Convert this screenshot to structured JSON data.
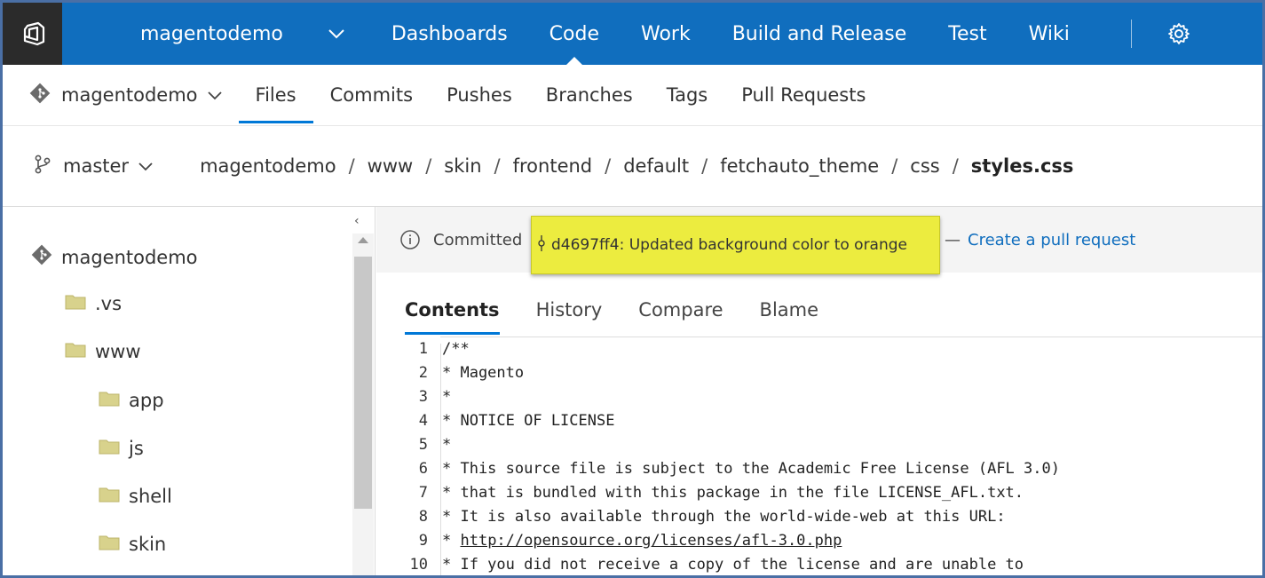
{
  "colors": {
    "nav_bg": "#106ebe",
    "logo_bg": "#2b2b2b",
    "accent": "#0078d7",
    "highlight": "#ecec3f",
    "link": "#106ebe"
  },
  "topnav": {
    "project": "magentodemo",
    "links": [
      "Dashboards",
      "Code",
      "Work",
      "Build and Release",
      "Test",
      "Wiki"
    ],
    "active": "Code",
    "icons": {
      "logo": "vsts-logo-icon",
      "project_dropdown": "chevron-down-icon",
      "settings": "gear-icon"
    }
  },
  "subnav": {
    "repo": "magentodemo",
    "tabs": [
      "Files",
      "Commits",
      "Pushes",
      "Branches",
      "Tags",
      "Pull Requests"
    ],
    "active": "Files"
  },
  "pathbar": {
    "branch": "master",
    "crumbs": [
      "magentodemo",
      "www",
      "skin",
      "frontend",
      "default",
      "fetchauto_theme",
      "css"
    ],
    "current": "styles.css"
  },
  "tree": {
    "items": [
      {
        "label": "magentodemo",
        "type": "repo"
      },
      {
        "label": ".vs",
        "type": "folder"
      },
      {
        "label": "www",
        "type": "folder"
      },
      {
        "label": "app",
        "type": "folder"
      },
      {
        "label": "js",
        "type": "folder"
      },
      {
        "label": "shell",
        "type": "folder"
      },
      {
        "label": "skin",
        "type": "folder"
      }
    ],
    "collapse_glyph": "‹"
  },
  "commit": {
    "prefix": "Committed",
    "hash": "d4697ff4: Updated background color to orange",
    "separator": "—",
    "link": "Create a pull request"
  },
  "content_tabs": {
    "tabs": [
      "Contents",
      "History",
      "Compare",
      "Blame"
    ],
    "active": "Contents"
  },
  "code_lines": [
    {
      "n": "1",
      "text": "/**"
    },
    {
      "n": "2",
      "text": "* Magento"
    },
    {
      "n": "3",
      "text": "*"
    },
    {
      "n": "4",
      "text": "* NOTICE OF LICENSE"
    },
    {
      "n": "5",
      "text": "*"
    },
    {
      "n": "6",
      "text": "* This source file is subject to the Academic Free License (AFL 3.0)"
    },
    {
      "n": "7",
      "text": "* that is bundled with this package in the file LICENSE_AFL.txt."
    },
    {
      "n": "8",
      "text": "* It is also available through the world-wide-web at this URL:"
    },
    {
      "n": "9",
      "text": "* ",
      "url": "http://opensource.org/licenses/afl-3.0.php"
    },
    {
      "n": "10",
      "text": "* If you did not receive a copy of the license and are unable to"
    }
  ]
}
